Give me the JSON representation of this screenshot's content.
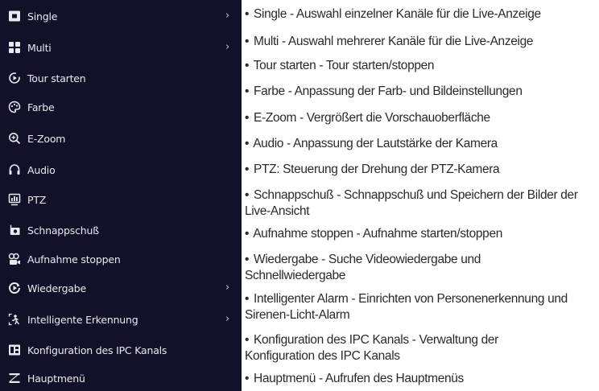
{
  "menu": {
    "items": [
      {
        "label": "Single",
        "icon": "single-view-icon",
        "has_submenu": true
      },
      {
        "label": "Multi",
        "icon": "multi-view-icon",
        "has_submenu": true
      },
      {
        "label": "Tour starten",
        "icon": "tour-icon",
        "has_submenu": false
      },
      {
        "label": "Farbe",
        "icon": "color-icon",
        "has_submenu": false
      },
      {
        "label": "E-Zoom",
        "icon": "zoom-icon",
        "has_submenu": false
      },
      {
        "label": "Audio",
        "icon": "headphones-icon",
        "has_submenu": false
      },
      {
        "label": "PTZ",
        "icon": "ptz-icon",
        "has_submenu": false
      },
      {
        "label": "Schnappschuß",
        "icon": "snapshot-icon",
        "has_submenu": false
      },
      {
        "label": "Aufnahme stoppen",
        "icon": "record-icon",
        "has_submenu": false
      },
      {
        "label": "Wiedergabe",
        "icon": "playback-icon",
        "has_submenu": true
      },
      {
        "label": "Intelligente Erkennung",
        "icon": "person-detect-icon",
        "has_submenu": true
      },
      {
        "label": "Konfiguration des IPC Kanals",
        "icon": "ipc-config-icon",
        "has_submenu": false
      },
      {
        "label": "Hauptmenü",
        "icon": "main-menu-icon",
        "has_submenu": false
      }
    ],
    "chevron": "›"
  },
  "descriptions": {
    "bullet": "•",
    "items": [
      "Single - Auswahl einzelner Kanäle für die Live-Anzeige",
      "Multi - Auswahl mehrerer Kanäle für die Live-Anzeige",
      "Tour starten - Tour starten/stoppen",
      "Farbe - Anpassung der Farb- und Bildeinstellungen",
      "E-Zoom - Vergrößert die Vorschauoberfläche",
      "Audio - Anpassung der Lautstärke der Kamera",
      "PTZ: Steuerung der Drehung der PTZ-Kamera",
      "Schnappschuß - Schnappschuß und Speichern der Bilder der Live-Ansicht",
      "Aufnahme stoppen - Aufnahme starten/stoppen",
      "Wiedergabe - Suche Videowiedergabe und Schnellwiedergabe",
      "Intelligenter Alarm - Einrichten von Personenerkennung und Sirenen-Licht-Alarm",
      "Konfiguration des IPC Kanals - Verwaltung der Konfiguration des IPC Kanals",
      "Hauptmenü - Aufrufen des Hauptmenüs"
    ]
  },
  "colors": {
    "menu_background": "#11122a",
    "menu_text": "#e9e9ef",
    "description_text": "#2a2a2a"
  }
}
